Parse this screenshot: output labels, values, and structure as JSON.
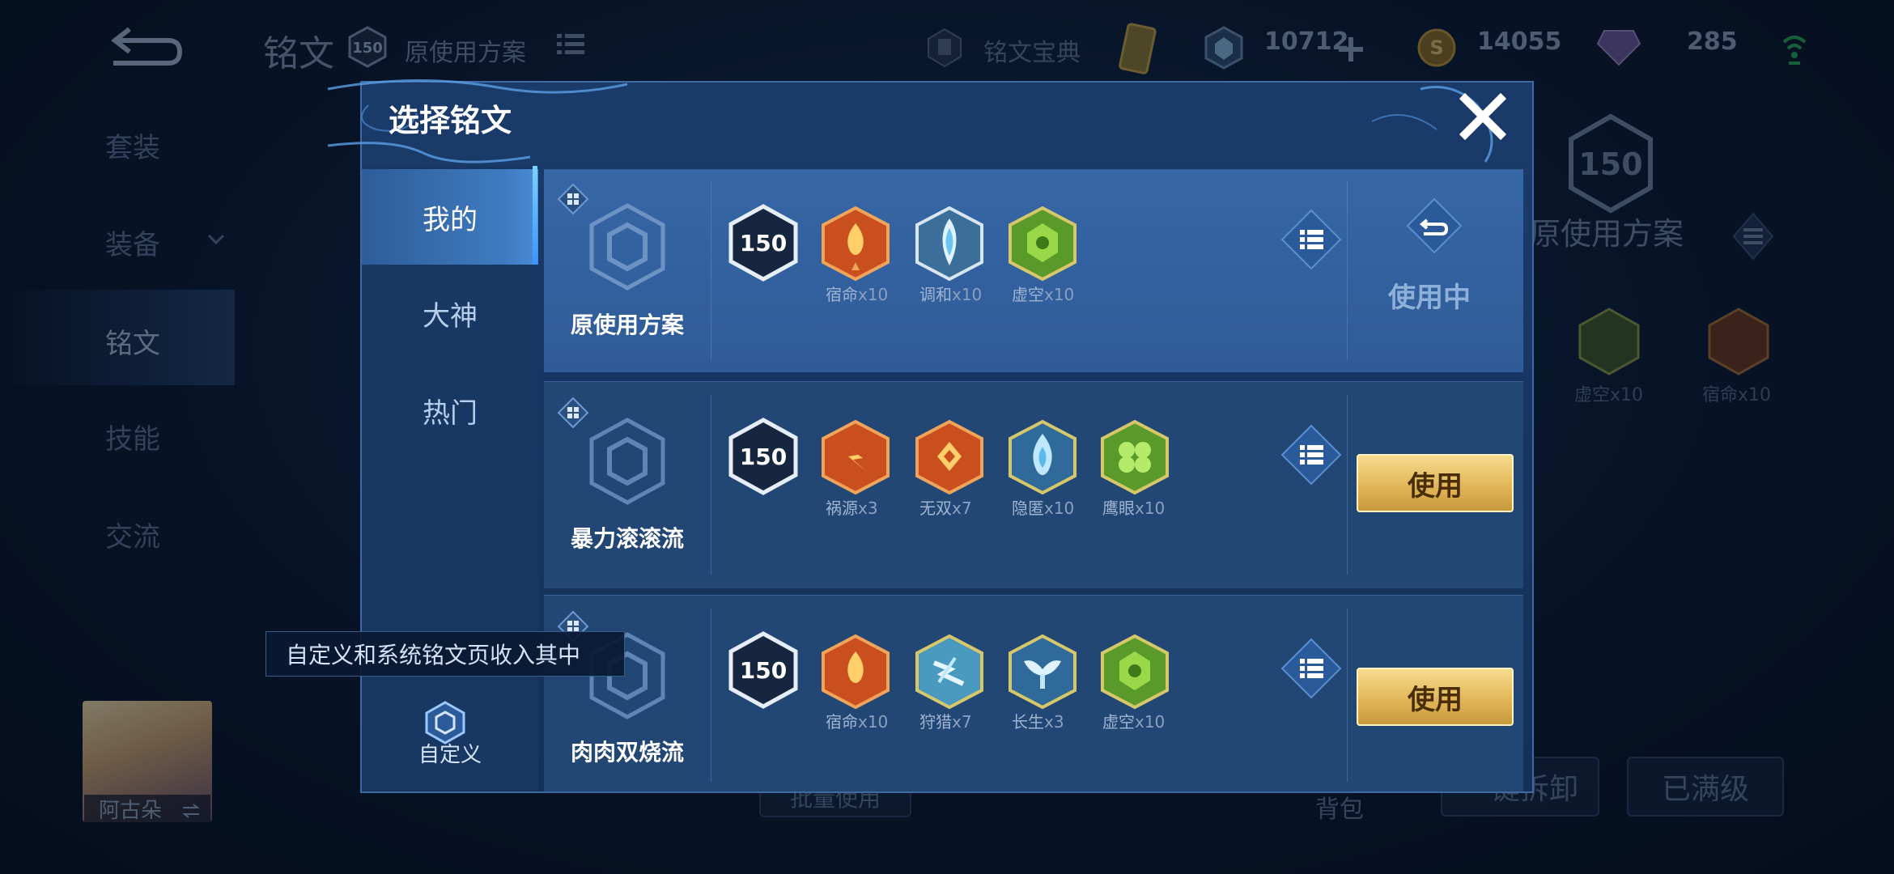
{
  "background": {
    "page_title": "铭文",
    "level": "150",
    "plan_name": "原使用方案",
    "codex_label": "铭文宝典",
    "resources": [
      {
        "icon": "diamond-coupon-icon",
        "value": "10712"
      },
      {
        "icon": "gold-coin-icon",
        "value": "14055"
      },
      {
        "icon": "rune-fragment-icon",
        "value": "285"
      }
    ],
    "sidebar": [
      {
        "label": "套装"
      },
      {
        "label": "装备"
      },
      {
        "label": "铭文"
      },
      {
        "label": "技能"
      },
      {
        "label": "交流"
      }
    ],
    "right_panel": {
      "level": "150",
      "plan_name": "原使用方案",
      "runes": [
        {
          "name": "虚空",
          "count": "x10"
        },
        {
          "name": "宿命",
          "count": "x10"
        }
      ]
    },
    "bottom_buttons": [
      "批量使用",
      "背包",
      "一键拆卸",
      "已满级"
    ],
    "hero_name": "阿古朵"
  },
  "modal": {
    "title": "选择铭文",
    "tabs": [
      {
        "label": "我的",
        "active": true
      },
      {
        "label": "大神",
        "active": false
      },
      {
        "label": "热门",
        "active": false
      }
    ],
    "custom_tab_label": "自定义",
    "tooltip": "自定义和系统铭文页收入其中",
    "plans": [
      {
        "name": "原使用方案",
        "level": "150",
        "status": "使用中",
        "runes": [
          {
            "name": "宿命",
            "count": "x10",
            "color": "red"
          },
          {
            "name": "调和",
            "count": "x10",
            "color": "blue"
          },
          {
            "name": "虚空",
            "count": "x10",
            "color": "green"
          }
        ]
      },
      {
        "name": "暴力滚滚流",
        "level": "150",
        "action": "使用",
        "runes": [
          {
            "name": "祸源",
            "count": "x3",
            "color": "red"
          },
          {
            "name": "无双",
            "count": "x7",
            "color": "red"
          },
          {
            "name": "隐匿",
            "count": "x10",
            "color": "blue"
          },
          {
            "name": "鹰眼",
            "count": "x10",
            "color": "green"
          }
        ]
      },
      {
        "name": "肉肉双烧流",
        "level": "150",
        "action": "使用",
        "runes": [
          {
            "name": "宿命",
            "count": "x10",
            "color": "red"
          },
          {
            "name": "狩猎",
            "count": "x7",
            "color": "blue"
          },
          {
            "name": "长生",
            "count": "x3",
            "color": "blue"
          },
          {
            "name": "虚空",
            "count": "x10",
            "color": "green"
          }
        ]
      }
    ]
  }
}
